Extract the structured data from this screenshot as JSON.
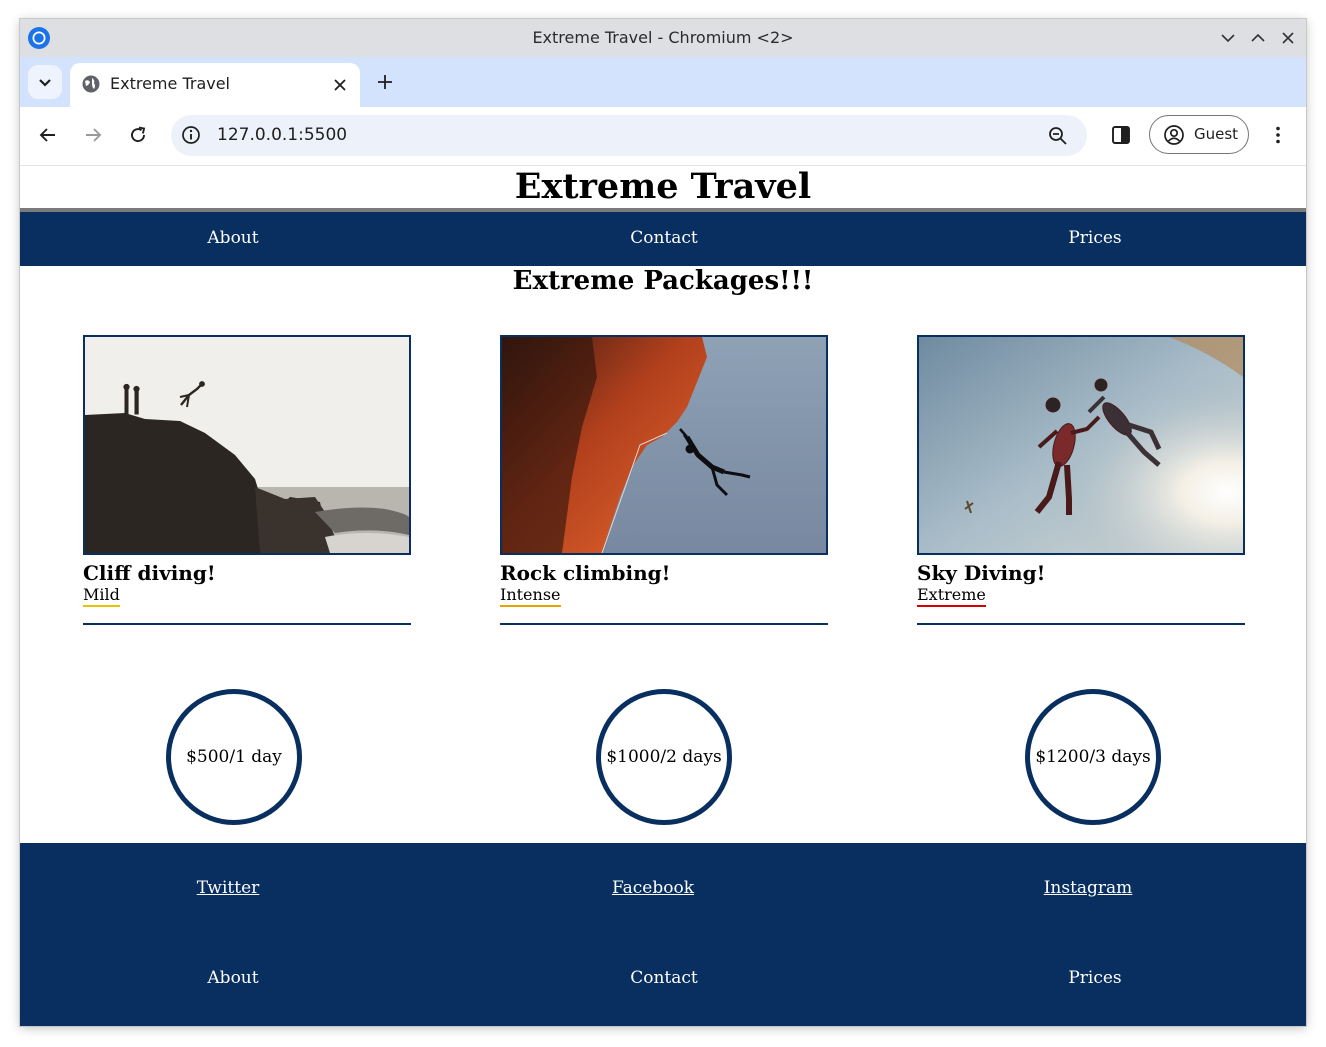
{
  "browser": {
    "window_title": "Extreme Travel - Chromium <2>",
    "tab_title": "Extreme Travel",
    "url": "127.0.0.1:5500",
    "profile_label": "Guest"
  },
  "site": {
    "title": "Extreme Travel",
    "nav": [
      "About",
      "Contact",
      "Prices"
    ],
    "packages_title": "Extreme Packages!!!",
    "cards": [
      {
        "title": "Cliff diving!",
        "level": "Mild",
        "level_color": "#e8c400",
        "photo": "cliff-diving-photo"
      },
      {
        "title": "Rock climbing!",
        "level": "Intense",
        "level_color": "#e8a300",
        "photo": "rock-climbing-photo"
      },
      {
        "title": "Sky Diving!",
        "level": "Extreme",
        "level_color": "#d40000",
        "photo": "sky-diving-photo"
      }
    ],
    "prices": [
      "$500/1 day",
      "$1000/2 days",
      "$1200/3 days"
    ],
    "social": [
      "Twitter",
      "Facebook",
      "Instagram"
    ],
    "footer_nav": [
      "About",
      "Contact",
      "Prices"
    ],
    "colors": {
      "navy": "#082f5f",
      "header_rule": "#7a7a7a"
    }
  }
}
